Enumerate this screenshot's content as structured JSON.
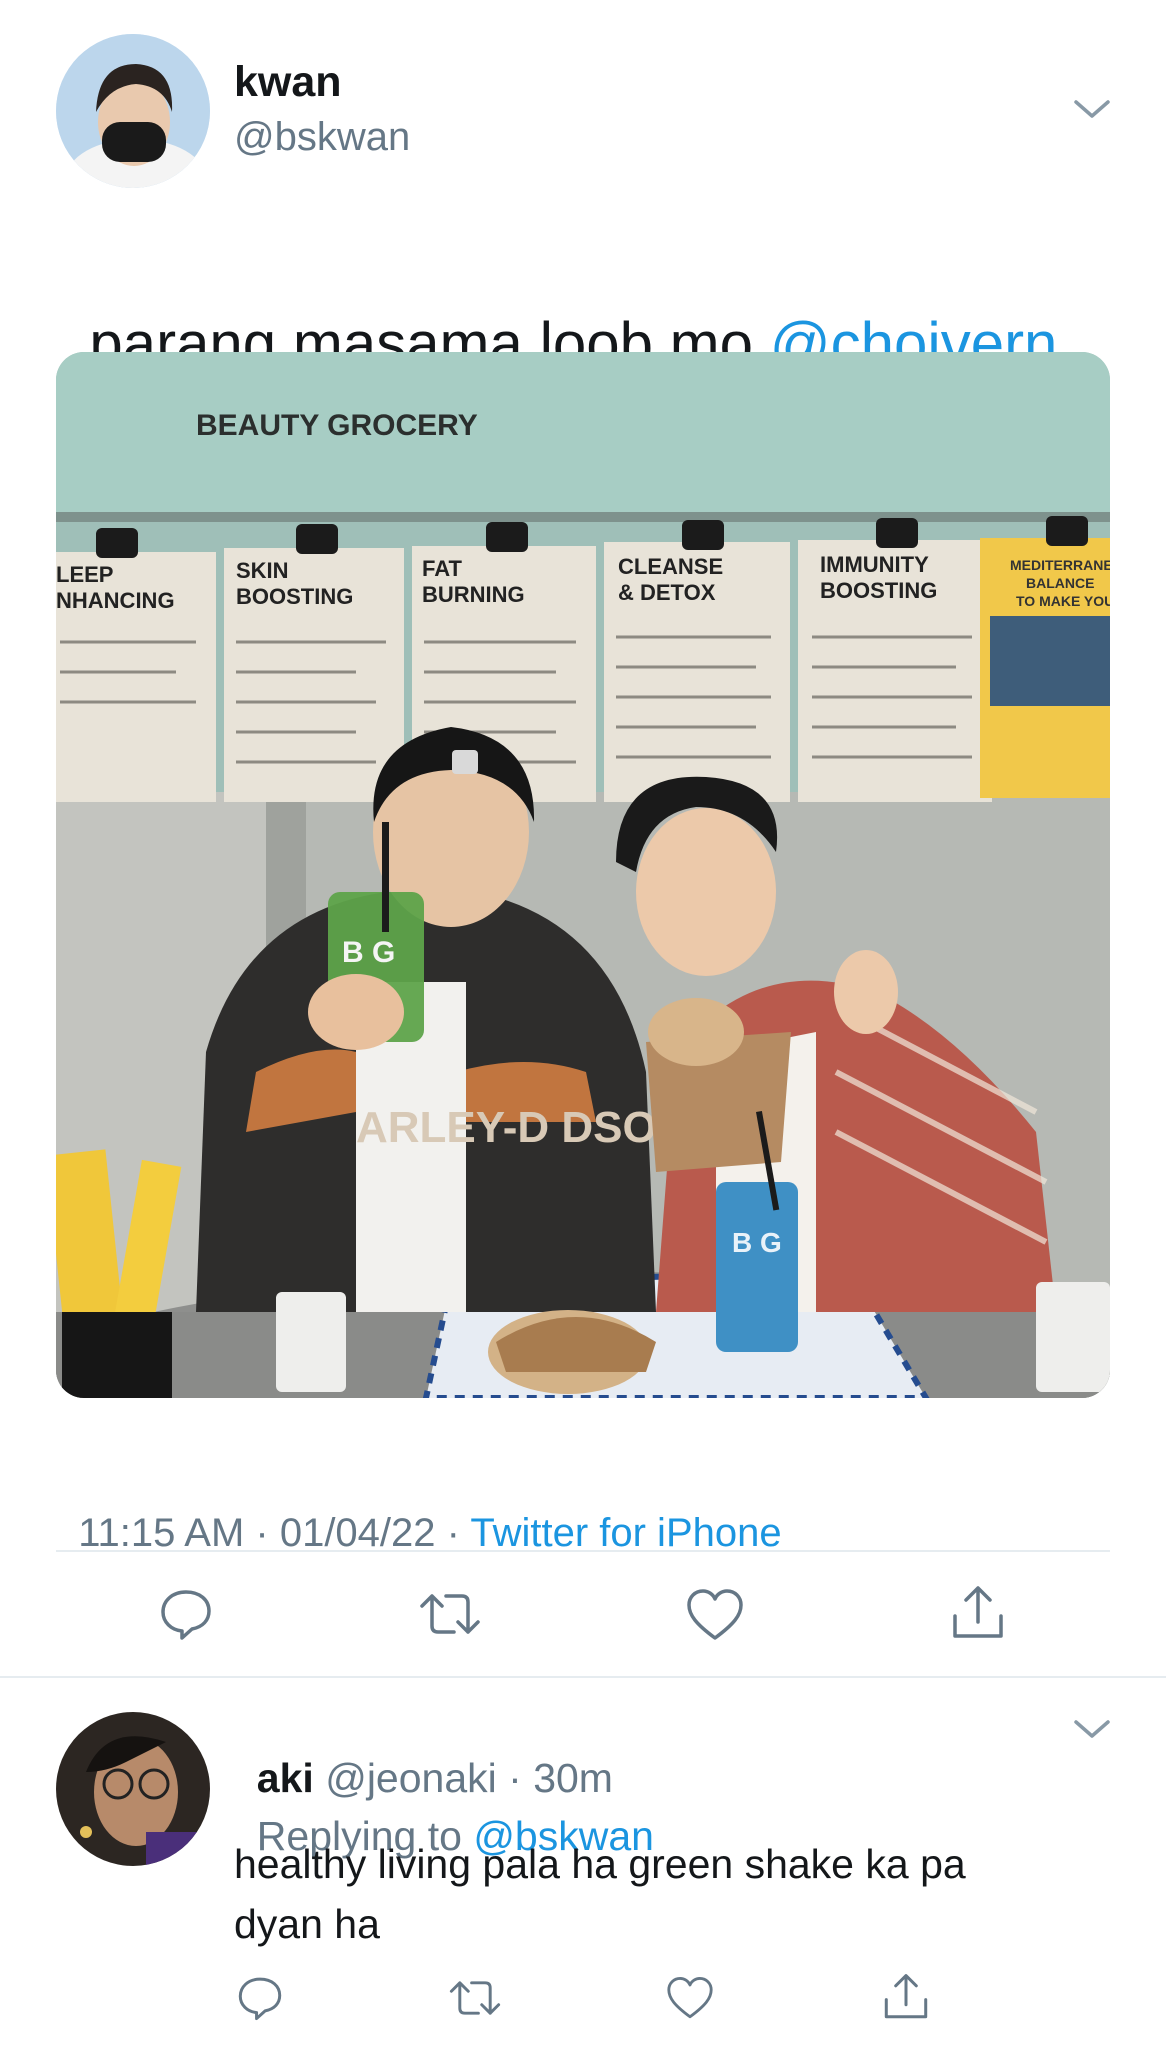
{
  "tweet": {
    "display_name": "kwan",
    "handle": "@bskwan",
    "text": "parang masama loob mo ",
    "mention": "@choivern",
    "time": "11:15 AM",
    "separator1": " · ",
    "date": "01/04/22",
    "separator2": " · ",
    "source": "Twitter for iPhone",
    "image": {
      "store_sign": "BEAUTY GROCERY",
      "menu_boards": [
        "LEEP\nNHANCING",
        "SKIN\nBOOSTING",
        "FAT\nBURNING",
        "CLEANSE\n& DETOX",
        "IMMUNITY\nBOOSTING",
        "MEDITERRANEA\nBALANCE\nTO MAKE YOU"
      ],
      "jacket_text": "ARLEY-D   DSO",
      "cup_logo": "B G"
    }
  },
  "reply": {
    "display_name": "aki",
    "handle": "@jeonaki",
    "dot": " · ",
    "time": "30m",
    "replying_prefix": "Replying to ",
    "replying_to": "@bskwan",
    "text_line1": "healthy living pala ha green shake ka pa",
    "text_line2": "dyan ha"
  },
  "icons": {
    "reply": "reply-icon",
    "retweet": "retweet-icon",
    "like": "heart-icon",
    "share": "share-icon",
    "menu": "chevron-down-icon"
  },
  "colors": {
    "link": "#1b95e0",
    "muted": "#657786",
    "text": "#14171a",
    "divider": "#e6ecf0"
  }
}
